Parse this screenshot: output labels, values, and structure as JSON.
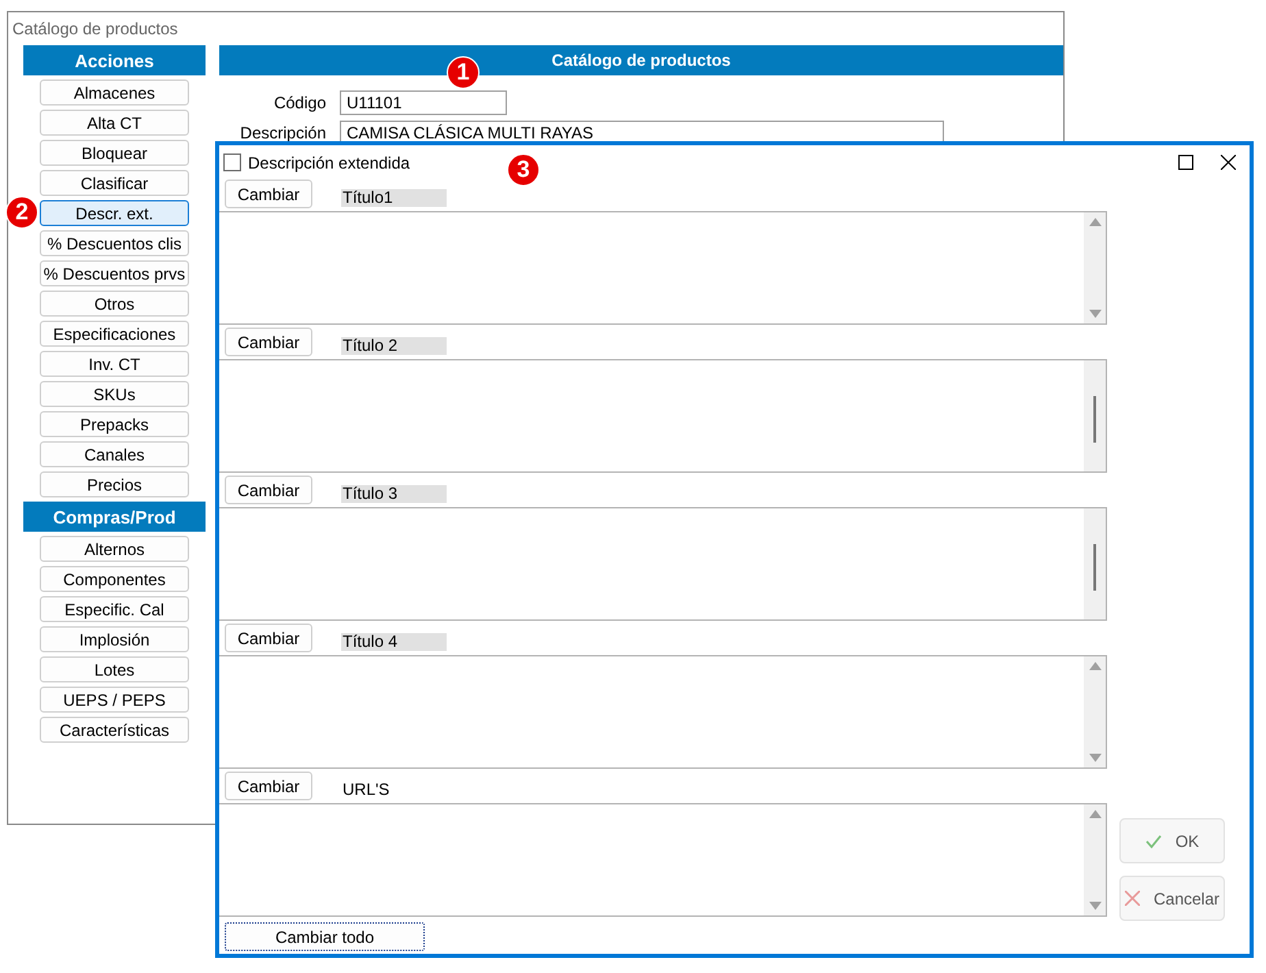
{
  "main_window": {
    "title": "Catálogo de productos",
    "sidebar": [
      {
        "header": "Acciones",
        "items": [
          {
            "label": "Almacenes",
            "selected": false
          },
          {
            "label": "Alta CT",
            "selected": false
          },
          {
            "label": "Bloquear",
            "selected": false
          },
          {
            "label": "Clasificar",
            "selected": false
          },
          {
            "label": "Descr. ext.",
            "selected": true
          },
          {
            "label": "%  Descuentos clis",
            "selected": false
          },
          {
            "label": "% Descuentos prvs",
            "selected": false
          },
          {
            "label": "Otros",
            "selected": false
          },
          {
            "label": "Especificaciones",
            "selected": false
          },
          {
            "label": "Inv. CT",
            "selected": false
          },
          {
            "label": "SKUs",
            "selected": false
          },
          {
            "label": "Prepacks",
            "selected": false
          },
          {
            "label": "Canales",
            "selected": false
          },
          {
            "label": "Precios",
            "selected": false
          }
        ]
      },
      {
        "header": "Compras/Prod",
        "items": [
          {
            "label": "Alternos",
            "selected": false
          },
          {
            "label": "Componentes",
            "selected": false
          },
          {
            "label": "Especific. Cal",
            "selected": false
          },
          {
            "label": "Implosión",
            "selected": false
          },
          {
            "label": "Lotes",
            "selected": false
          },
          {
            "label": "UEPS / PEPS",
            "selected": false
          },
          {
            "label": "Características",
            "selected": false
          }
        ]
      }
    ],
    "header": "Catálogo de productos",
    "fields": [
      {
        "label": "Código",
        "value": "U11101"
      },
      {
        "label": "Descripción",
        "value": "CAMISA CLÁSICA MULTI RAYAS"
      }
    ]
  },
  "dialog": {
    "checkbox": {
      "label": "Descripción extendida",
      "checked": false
    },
    "sections": [
      {
        "button": "Cambiar",
        "title": "Título1",
        "shaded": true,
        "scroll_arrows": true
      },
      {
        "button": "Cambiar",
        "title": "Título 2",
        "shaded": true,
        "scroll_arrows": false
      },
      {
        "button": "Cambiar",
        "title": "Título 3",
        "shaded": true,
        "scroll_arrows": false
      },
      {
        "button": "Cambiar",
        "title": "Título 4",
        "shaded": true,
        "scroll_arrows": true
      },
      {
        "button": "Cambiar",
        "title": "URL'S",
        "shaded": false,
        "scroll_arrows": true
      }
    ],
    "change_all": "Cambiar todo",
    "ok": "OK",
    "cancel": "Cancelar"
  },
  "markers": [
    "1",
    "2",
    "3"
  ]
}
